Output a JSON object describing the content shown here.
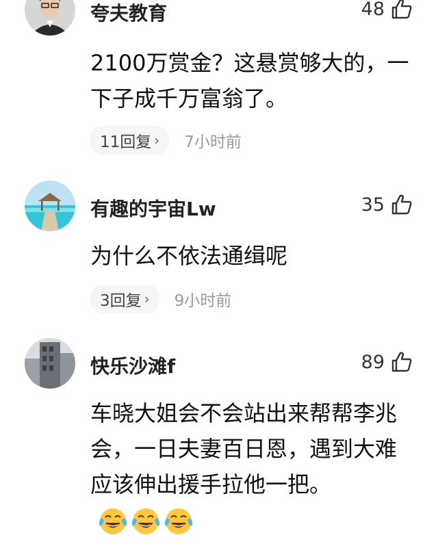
{
  "comments": [
    {
      "username": "夸夫教育",
      "likes": "48",
      "text": "2100万赏金？这悬赏够大的，一下子成千万富翁了。",
      "replies": "11回复",
      "time": "7小时前",
      "avatar": "man-portrait-avatar"
    },
    {
      "username": "有趣的宇宙Lw",
      "likes": "35",
      "text": "为什么不依法通缉呢",
      "replies": "3回复",
      "time": "9小时前",
      "avatar": "beach-pavilion-avatar"
    },
    {
      "username": "快乐沙滩f",
      "likes": "89",
      "text": "车晓大姐会不会站出来帮帮李兆会，一日夫妻百日恩，遇到大难应该伸出援手拉他一把。",
      "emojis": [
        "crying-laughing-emoji",
        "crying-laughing-emoji",
        "crying-laughing-emoji"
      ],
      "avatar": "building-avatar"
    }
  ],
  "icons": {
    "like": "thumbs-up-icon",
    "chevron": "›"
  },
  "colors": {
    "text": "#111111",
    "meta": "#9a9a9a",
    "pill_bg": "#f6f6f8"
  }
}
